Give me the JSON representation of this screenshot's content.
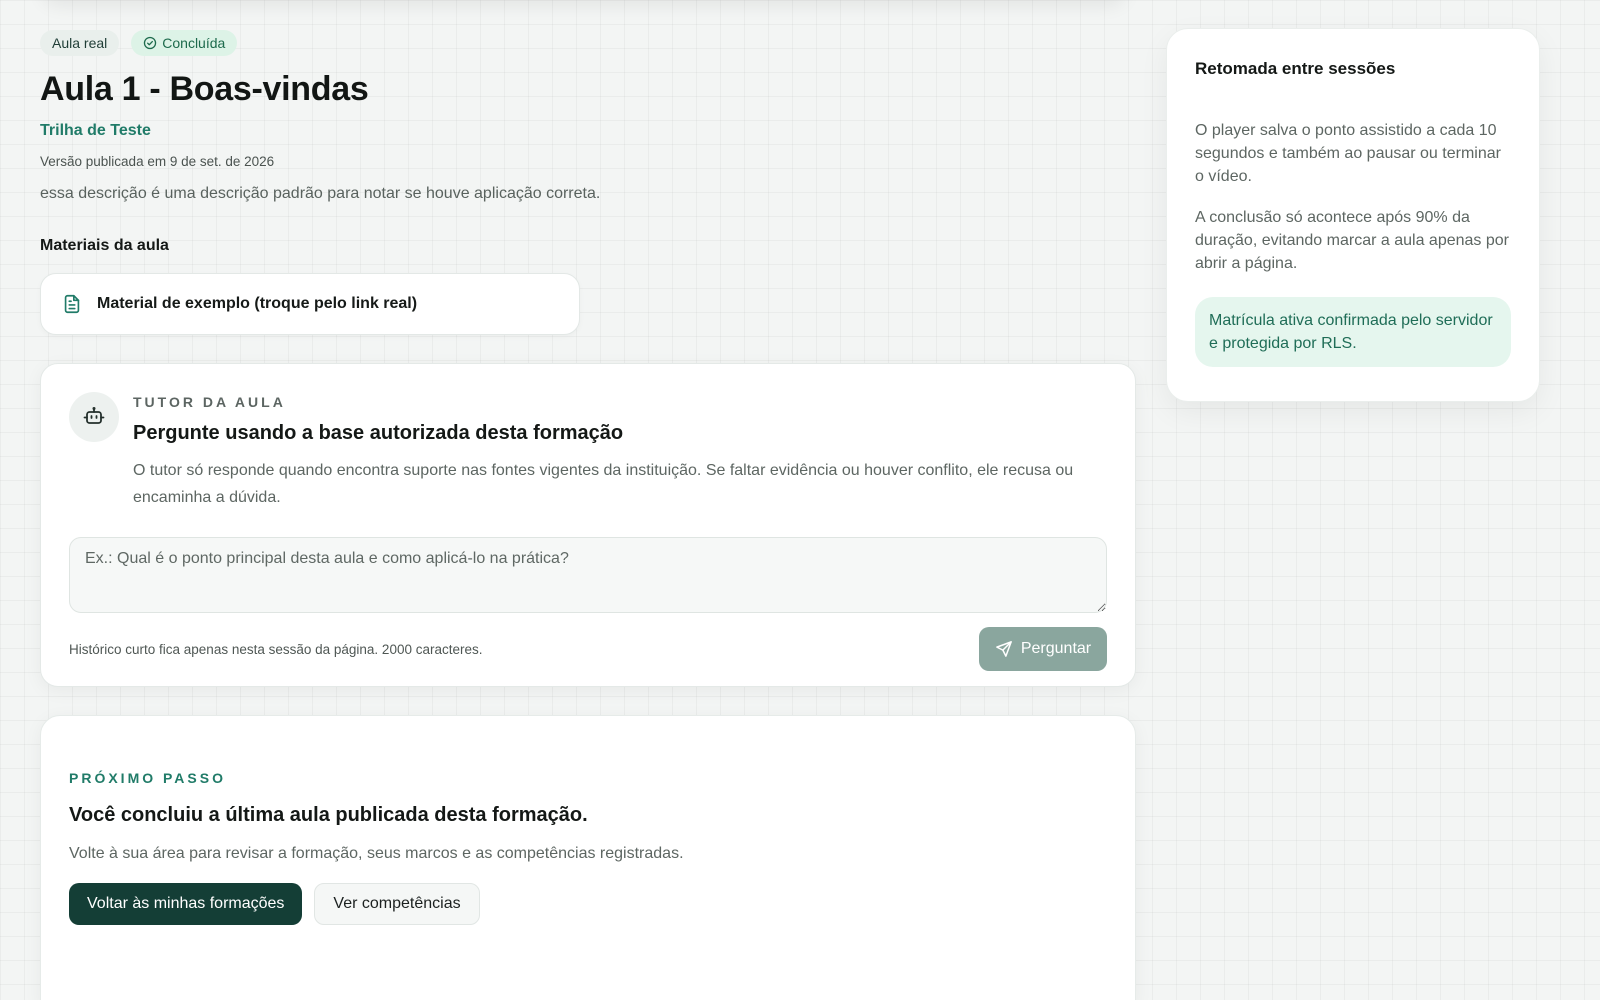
{
  "lesson": {
    "badge_kind": "Aula real",
    "badge_status": "Concluída",
    "title": "Aula 1 - Boas-vindas",
    "track": "Trilha de Teste",
    "version": "Versão publicada em 9 de set. de 2026",
    "description": "essa descrição é uma descrição padrão para notar se houve aplicação correta."
  },
  "materials": {
    "heading": "Materiais da aula",
    "items": [
      {
        "label": "Material de exemplo (troque pelo link real)",
        "icon": "file-text-icon"
      }
    ]
  },
  "tutor": {
    "icon": "robot-icon",
    "eyebrow": "TUTOR DA AULA",
    "title": "Pergunte usando a base autorizada desta formação",
    "description": "O tutor só responde quando encontra suporte nas fontes vigentes da instituição. Se faltar evidência ou houver conflito, ele recusa ou encaminha a dúvida.",
    "input_value": "",
    "input_placeholder": "Ex.: Qual é o ponto principal desta aula e como aplicá-lo na prática?",
    "hint": "Histórico curto fica apenas nesta sessão da página. 2000 caracteres.",
    "ask_label": "Perguntar",
    "ask_icon": "send-icon"
  },
  "next_step": {
    "eyebrow": "PRÓXIMO PASSO",
    "title": "Você concluiu a última aula publicada desta formação.",
    "description": "Volte à sua área para revisar a formação, seus marcos e as competências registradas.",
    "primary_label": "Voltar às minhas formações",
    "secondary_label": "Ver competências"
  },
  "resume": {
    "title": "Retomada entre sessões",
    "p1": "O player salva o ponto assistido a cada 10 segundos e também ao pausar ou terminar o vídeo.",
    "p2": "A conclusão só acontece após 90% da duração, evitando marcar a aula apenas por abrir a página.",
    "note": "Matrícula ativa confirmada pelo servidor e protegida por RLS."
  },
  "colors": {
    "accent": "#207b68",
    "primary_button": "#143e36",
    "ask_button_disabled": "#8aa69e",
    "success_bg": "#ddf3e7"
  }
}
